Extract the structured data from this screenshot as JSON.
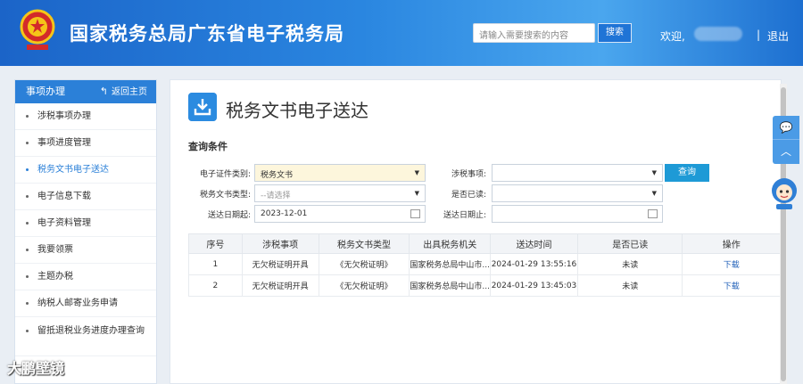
{
  "header": {
    "title": "国家税务总局广东省电子税务局",
    "search_placeholder": "请输入需要搜索的内容",
    "search_button": "搜索",
    "welcome": "欢迎,",
    "separator": "|",
    "logout": "退出"
  },
  "sidebar": {
    "title": "事项办理",
    "return_home": "返回主页",
    "items": [
      {
        "label": "涉税事项办理"
      },
      {
        "label": "事项进度管理"
      },
      {
        "label": "税务文书电子送达"
      },
      {
        "label": "电子信息下载"
      },
      {
        "label": "电子资料管理"
      },
      {
        "label": "我要领票"
      },
      {
        "label": "主题办税"
      },
      {
        "label": "纳税人邮寄业务申请"
      },
      {
        "label": "留抵退税业务进度办理查询"
      }
    ]
  },
  "main": {
    "title": "税务文书电子送达",
    "section_title": "查询条件",
    "form": {
      "cert_type_label": "电子证件类别:",
      "cert_type_value": "税务文书",
      "doc_type_label": "税务文书类型:",
      "doc_type_value": "--请选择",
      "start_date_label": "送达日期起:",
      "start_date_value": "2023-12-01",
      "matter_label": "涉税事项:",
      "matter_value": "",
      "read_label": "是否已读:",
      "read_value": "",
      "end_date_label": "送达日期止:",
      "end_date_value": "",
      "query_button": "查询"
    },
    "table": {
      "headers": [
        "序号",
        "涉税事项",
        "税务文书类型",
        "出具税务机关",
        "送达时间",
        "是否已读",
        "操作"
      ],
      "rows": [
        [
          "1",
          "无欠税证明开具",
          "《无欠税证明》",
          "国家税务总局中山市...",
          "2024-01-29 13:55:16",
          "未读",
          "下载"
        ],
        [
          "2",
          "无欠税证明开具",
          "《无欠税证明》",
          "国家税务总局中山市...",
          "2024-01-29 13:45:03",
          "未读",
          "下载"
        ]
      ]
    }
  },
  "watermark": "大鹏壁镜",
  "colors": {
    "header_blue": "#1b64c8",
    "sidebar_active": "#2b80d8",
    "query_button": "#1e9ad6",
    "link": "#1f5fb8"
  }
}
